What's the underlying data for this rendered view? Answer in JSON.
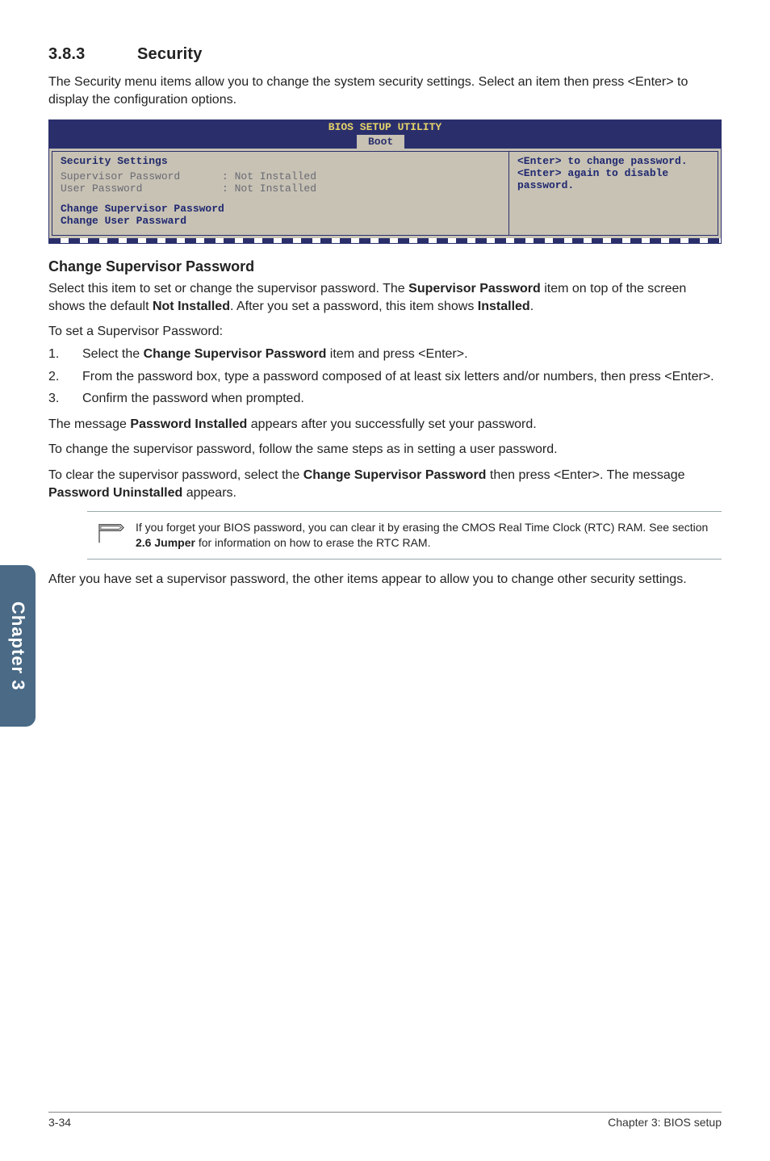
{
  "section": {
    "number": "3.8.3",
    "title": "Security"
  },
  "intro": "The Security menu items allow you to change the system security settings. Select an item then press <Enter> to display the configuration options.",
  "bios": {
    "title": "BIOS SETUP UTILITY",
    "tab": "Boot",
    "heading": "Security Settings",
    "rows": [
      {
        "label": "Supervisor Password",
        "value": ": Not Installed"
      },
      {
        "label": "User Password",
        "value": ": Not Installed"
      }
    ],
    "links": [
      "Change Supervisor Password",
      "Change User Passward"
    ],
    "help": "<Enter> to change password.\n<Enter> again to disable password."
  },
  "subhead": "Change Supervisor Password",
  "para1_a": "Select this item to set or change the supervisor password. The ",
  "para1_b": "Supervisor Password",
  "para1_c": " item on top of the screen shows the default ",
  "para1_d": "Not Installed",
  "para1_e": ". After you set a password, this item shows ",
  "para1_f": "Installed",
  "para1_g": ".",
  "para2": "To set a Supervisor Password:",
  "steps": {
    "s1_a": "Select the ",
    "s1_b": "Change Supervisor Password",
    "s1_c": " item and press <Enter>.",
    "s2": "From the password box, type a password composed of at least six letters and/or numbers, then press <Enter>.",
    "s3": "Confirm the password when prompted."
  },
  "para3_a": "The message ",
  "para3_b": "Password Installed",
  "para3_c": " appears after you successfully set your password.",
  "para4": "To change the supervisor password, follow the same steps as in setting a user password.",
  "para5_a": "To clear the supervisor password, select the ",
  "para5_b": "Change Supervisor Password",
  "para5_c": " then press <Enter>. The message ",
  "para5_d": "Password Uninstalled",
  "para5_e": " appears.",
  "note_a": "If you forget your BIOS password, you can clear it by erasing the CMOS Real Time Clock (RTC) RAM. See section ",
  "note_b": "2.6 Jumper",
  "note_c": " for information on how to erase the RTC RAM.",
  "para6": "After you have set a supervisor password, the other items appear to allow you to change other security settings.",
  "sidetab": "Chapter 3",
  "footer": {
    "left": "3-34",
    "right": "Chapter 3: BIOS setup"
  }
}
